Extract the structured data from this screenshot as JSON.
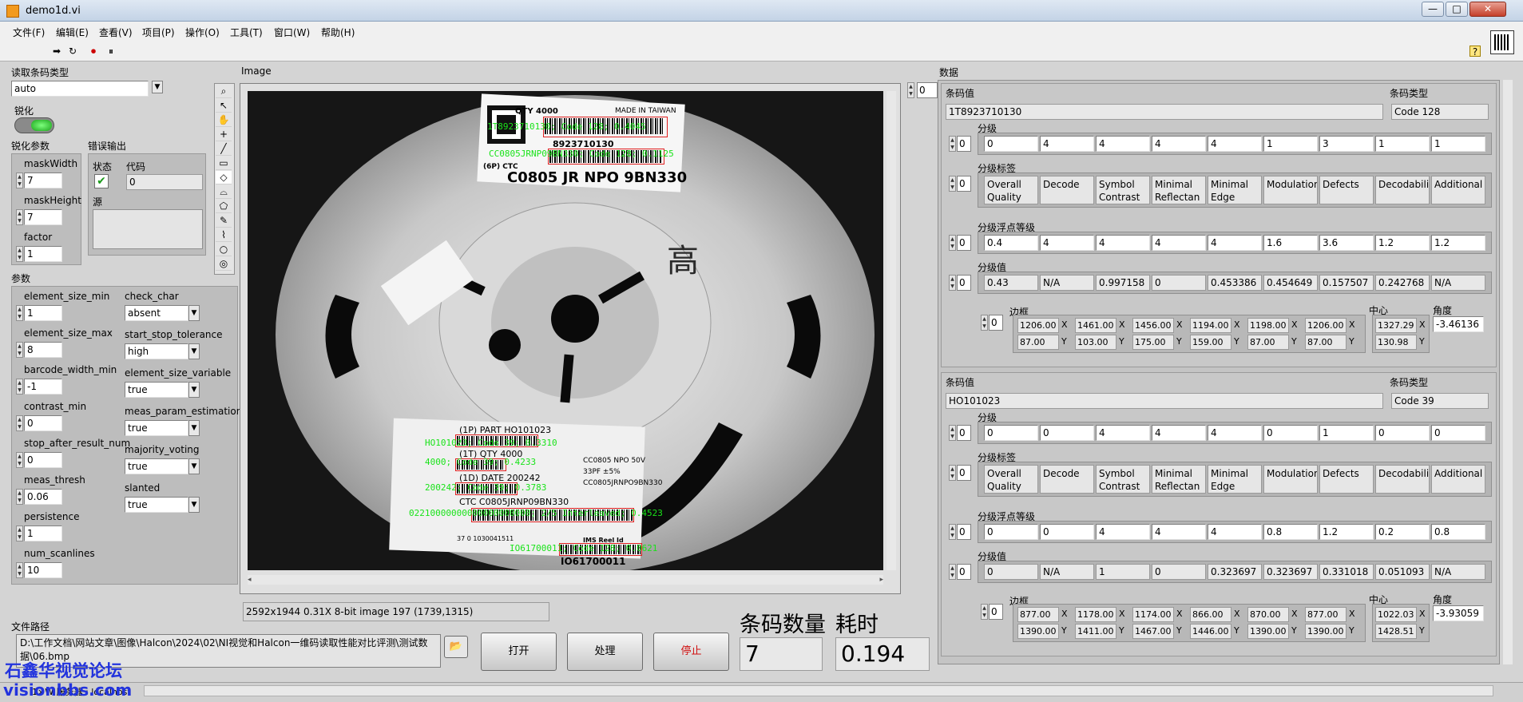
{
  "window": {
    "title": "demo1d.vi",
    "min": "—",
    "max": "□",
    "close": "✕"
  },
  "menu": [
    "文件(F)",
    "编辑(E)",
    "查看(V)",
    "项目(P)",
    "操作(O)",
    "工具(T)",
    "窗口(W)",
    "帮助(H)"
  ],
  "toolbar": {
    "run": "➡",
    "run_cont": "↻",
    "abort": "⏺",
    "pause": "⏸",
    "help": "?"
  },
  "left": {
    "barcode_type_label": "读取条码类型",
    "barcode_type_value": "auto",
    "sharpen_label": "锐化",
    "sharpen_params_label": "锐化参数",
    "maskWidth_label": "maskWidth",
    "maskWidth": "7",
    "maskHeight_label": "maskHeight",
    "maskHeight": "7",
    "factor_label": "factor",
    "factor": "1",
    "error_out_label": "错误输出",
    "status_label": "状态",
    "code_label": "代码",
    "code_value": "0",
    "source_label": "源",
    "params_label": "参数",
    "params": [
      {
        "label": "element_size_min",
        "value": "1"
      },
      {
        "label": "element_size_max",
        "value": "8"
      },
      {
        "label": "barcode_width_min",
        "value": "-1"
      },
      {
        "label": "contrast_min",
        "value": "0"
      },
      {
        "label": "stop_after_result_num",
        "value": "0"
      },
      {
        "label": "meas_thresh",
        "value": "0.06"
      },
      {
        "label": "persistence",
        "value": "1"
      },
      {
        "label": "num_scanlines",
        "value": "10"
      }
    ],
    "params2": [
      {
        "label": "check_char",
        "value": "absent"
      },
      {
        "label": "start_stop_tolerance",
        "value": "high"
      },
      {
        "label": "element_size_variable",
        "value": "true"
      },
      {
        "label": "meas_param_estimation",
        "value": "true"
      },
      {
        "label": "majority_voting",
        "value": "true"
      },
      {
        "label": "slanted",
        "value": "true"
      }
    ],
    "filepath_label": "文件路径",
    "filepath": "D:\\工作文档\\网站文章\\图像\\Halcon\\2024\\02\\NI视觉和Halcon一维码读取性能对比评测\\测试数据\\06.bmp"
  },
  "image": {
    "label": "Image",
    "status": "2592x1944 0.31X 8-bit image 197     (1739,1315)",
    "label_top": {
      "qty": "QTY 4000",
      "made": "MADE IN TAIWAN",
      "num": "8923710130",
      "part": "C0805 JR NPO 9BN330",
      "ctc": "(6P) CTC"
    },
    "label_bottom": {
      "part": "(1P) PART HO101023",
      "qty": "(1T) QTY 4000",
      "date": "(1D) DATE 200242",
      "ctc": "CTC C0805JRNP09BN330",
      "spec1": "CC0805  NPO  50V",
      "spec2": "33PF  ±5%",
      "spec3": "CC0805JRNPO9BN330",
      "reel": "IMS Reel Id",
      "reelnum": "IO61700011",
      "lot": "37 0 1030041511"
    },
    "handwriting": "高",
    "overlays": [
      "1T8923710130; Code 128; 0.4045",
      "CC0805JRNP09BN330; Code 128; 0.1125",
      "HO101023; Code 39; 0.3310",
      "4000; Code 39; 0.4233",
      "200242; Code 39; 0.3783",
      "02210000000000000000000; 2/5 Interleaved; 0.4523",
      "IO61700011; Code 128; 0.0621"
    ]
  },
  "actions": {
    "open": "打开",
    "process": "处理",
    "stop": "停止",
    "count_label": "条码数量",
    "count": "7",
    "time_label": "耗时",
    "time": "0.194"
  },
  "data": {
    "label": "数据",
    "index": "0",
    "value_label": "条码值",
    "type_label": "条码类型",
    "grade_label": "分级",
    "grade_tags_label": "分级标签",
    "grade_float_label": "分级浮点等级",
    "grade_value_label": "分级值",
    "border_label": "边框",
    "center_label": "中心",
    "angle_label": "角度",
    "x": "X",
    "y": "Y",
    "tags": [
      "Overall Quality",
      "Decode",
      "Symbol Contrast",
      "Minimal Reflectan",
      "Minimal Edge",
      "Modulation",
      "Defects",
      "Decodability",
      "Additional"
    ],
    "records": [
      {
        "value": "1T8923710130",
        "type": "Code 128",
        "grades": [
          "0",
          "4",
          "4",
          "4",
          "4",
          "1",
          "3",
          "1",
          "1"
        ],
        "float": [
          "0.4",
          "4",
          "4",
          "4",
          "4",
          "1.6",
          "3.6",
          "1.2",
          "1.2"
        ],
        "gvals": [
          "0.43",
          "N/A",
          "0.997158",
          "0",
          "0.453386",
          "0.454649",
          "0.157507",
          "0.242768",
          "N/A"
        ],
        "bx": [
          "1206.00",
          "1461.00",
          "1456.00",
          "1194.00",
          "1198.00",
          "1206.00"
        ],
        "by": [
          "87.00",
          "103.00",
          "175.00",
          "159.00",
          "87.00",
          "87.00"
        ],
        "cx": "1327.29",
        "cy": "130.98",
        "angle": "-3.46136"
      },
      {
        "value": "HO101023",
        "type": "Code 39",
        "grades": [
          "0",
          "0",
          "4",
          "4",
          "4",
          "0",
          "1",
          "0",
          "0"
        ],
        "float": [
          "0",
          "0",
          "4",
          "4",
          "4",
          "0.8",
          "1.2",
          "0.2",
          "0.8"
        ],
        "gvals": [
          "0",
          "N/A",
          "1",
          "0",
          "0.323697",
          "0.323697",
          "0.331018",
          "0.051093",
          "N/A"
        ],
        "bx": [
          "877.00",
          "1178.00",
          "1174.00",
          "866.00",
          "870.00",
          "877.00"
        ],
        "by": [
          "1390.00",
          "1411.00",
          "1467.00",
          "1446.00",
          "1390.00",
          "1390.00"
        ],
        "cx": "1022.03",
        "cy": "1428.51",
        "angle": "-3.93059"
      }
    ]
  },
  "footer": {
    "watermark1": "石鑫华视觉论坛",
    "watermark2": "visionbbs.com",
    "server": "1×W  服务器 : localhost"
  }
}
